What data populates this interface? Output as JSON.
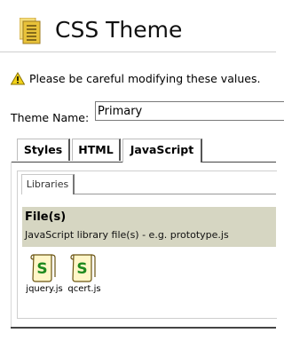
{
  "header": {
    "title": "CSS Theme",
    "icon": "folder-document-icon"
  },
  "warning": {
    "icon": "warning-icon",
    "text": "Please be careful modifying these values."
  },
  "form": {
    "theme_name_label": "Theme Name:",
    "theme_name_value": "Primary"
  },
  "tabs": [
    {
      "label": "Styles",
      "active": false
    },
    {
      "label": "HTML",
      "active": false
    },
    {
      "label": "JavaScript",
      "active": true
    }
  ],
  "subtabs": [
    {
      "label": "Libraries",
      "active": true
    }
  ],
  "files_section": {
    "title": "File(s)",
    "description": "JavaScript library file(s) - e.g. prototype.js",
    "files": [
      {
        "name": "jquery.js",
        "icon": "script-file-icon"
      },
      {
        "name": "qcert.js",
        "icon": "script-file-icon"
      }
    ]
  },
  "colors": {
    "section_header_bg": "#d6d6c2",
    "title_icon": "#e8c23a",
    "warning_icon": "#f2d21a"
  }
}
